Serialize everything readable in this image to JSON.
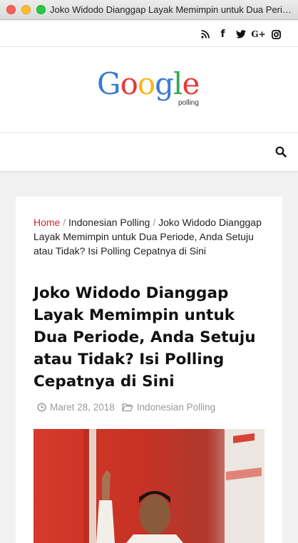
{
  "window": {
    "title": "Joko Widodo Dianggap Layak Memimpin untuk Dua Periode, Anda Setuju atau Tidak? Isi Polling Cepatnya di Sini"
  },
  "social": {
    "icons": [
      "rss-icon",
      "facebook-icon",
      "twitter-icon",
      "google-plus-icon",
      "instagram-icon"
    ],
    "labels": {
      "rss": "",
      "facebook": "f",
      "twitter": "",
      "gplus": "G+",
      "instagram": ""
    }
  },
  "logo": {
    "letters": [
      {
        "char": "G",
        "color": "#3a7bd5"
      },
      {
        "char": "o",
        "color": "#e53935"
      },
      {
        "char": "o",
        "color": "#f9b70f"
      },
      {
        "char": "g",
        "color": "#3a7bd5"
      },
      {
        "char": "l",
        "color": "#34a853"
      },
      {
        "char": "e",
        "color": "#e53935"
      }
    ],
    "sub": "polling"
  },
  "breadcrumb": {
    "home": "Home",
    "sep1": "/",
    "category": "Indonesian Polling",
    "sep2": "/",
    "current": "Joko Widodo Dianggap Layak Memimpin untuk Dua Periode, Anda Setuju atau Tidak? Isi Polling Cepatnya di Sini"
  },
  "post": {
    "title": "Joko Widodo Dianggap Layak Memimpin untuk Dua Periode, Anda Setuju atau Tidak? Isi Polling Cepatnya di Sini",
    "date": "Maret 28, 2018",
    "category": "Indonesian Polling"
  },
  "colors": {
    "accent": "#d1262c",
    "meta": "#9a9a9a"
  }
}
